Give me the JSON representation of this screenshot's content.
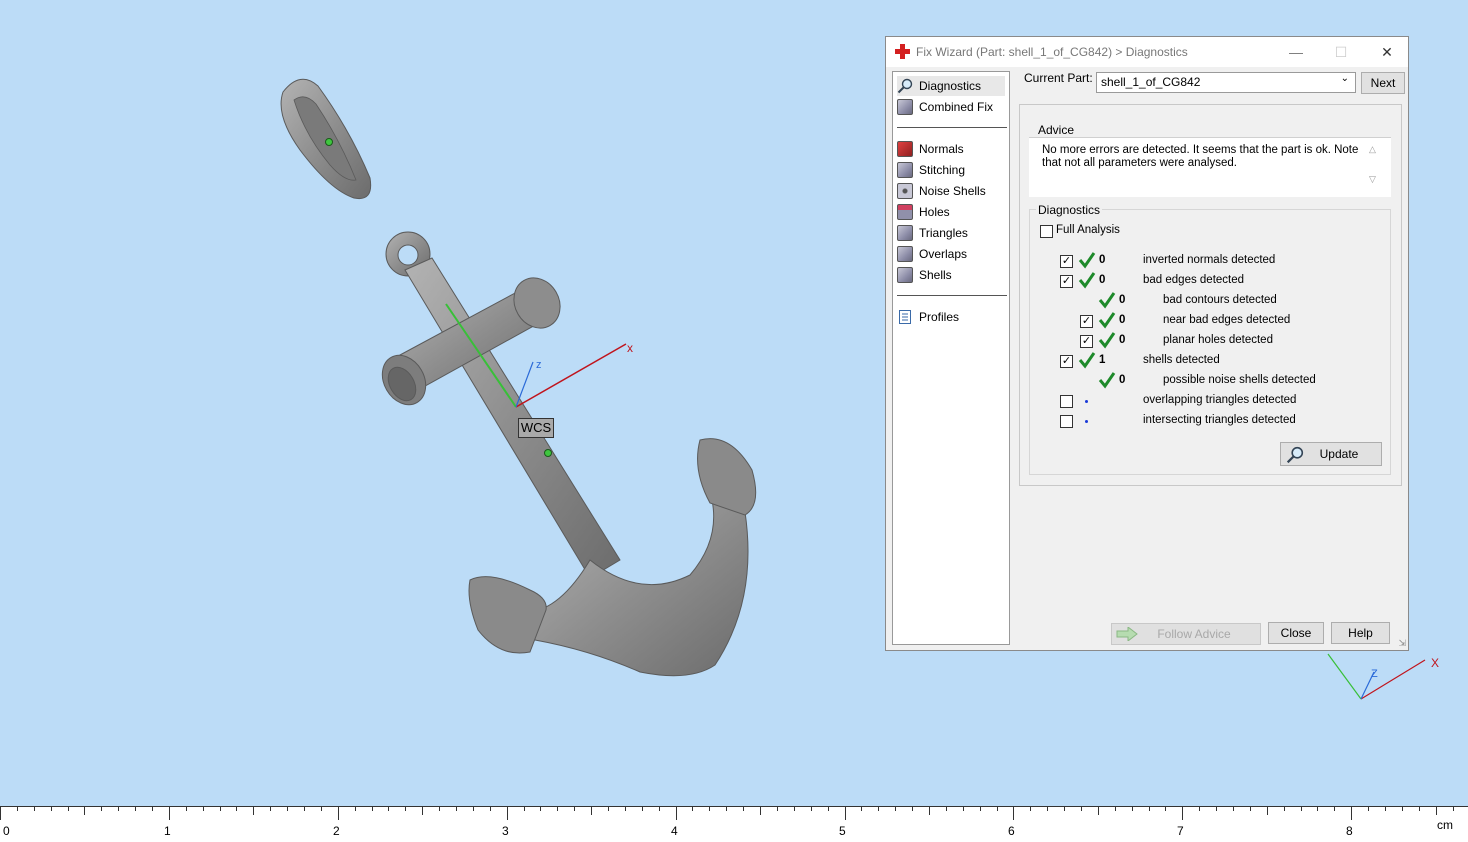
{
  "viewport": {
    "wcs_label": "WCS",
    "axis_x": "x",
    "axis_z": "z",
    "mini_axis_x": "X",
    "mini_axis_z": "Z"
  },
  "ruler": {
    "ticks": [
      "0",
      "1",
      "2",
      "3",
      "4",
      "5",
      "6",
      "7",
      "8"
    ],
    "unit": "cm"
  },
  "dialog": {
    "title": "Fix Wizard (Part: shell_1_of_CG842) > Diagnostics",
    "minimize": "—",
    "maximize": "☐",
    "close": "✕",
    "nav": {
      "diagnostics": "Diagnostics",
      "combined_fix": "Combined Fix",
      "normals": "Normals",
      "stitching": "Stitching",
      "noise_shells": "Noise Shells",
      "holes": "Holes",
      "triangles": "Triangles",
      "overlaps": "Overlaps",
      "shells": "Shells",
      "profiles": "Profiles"
    },
    "current_part_label": "Current Part:",
    "current_part_value": "shell_1_of_CG842",
    "next_button": "Next",
    "advice_title": "Advice",
    "advice_text": "No more errors are detected. It seems that the part is ok. Note that not all parameters were analysed.",
    "diagnostics_title": "Diagnostics",
    "full_analysis": "Full Analysis",
    "rows": [
      {
        "label": "inverted normals detected",
        "count": "0"
      },
      {
        "label": "bad edges detected",
        "count": "0"
      },
      {
        "label": "bad contours detected",
        "count": "0"
      },
      {
        "label": "near bad edges detected",
        "count": "0"
      },
      {
        "label": "planar holes detected",
        "count": "0"
      },
      {
        "label": "shells detected",
        "count": "1"
      },
      {
        "label": "possible noise shells detected",
        "count": "0"
      },
      {
        "label": "overlapping triangles detected",
        "count": ""
      },
      {
        "label": "intersecting triangles detected",
        "count": ""
      }
    ],
    "update_button": "Update",
    "follow_advice_button": "Follow Advice",
    "close_button": "Close",
    "help_button": "Help"
  }
}
